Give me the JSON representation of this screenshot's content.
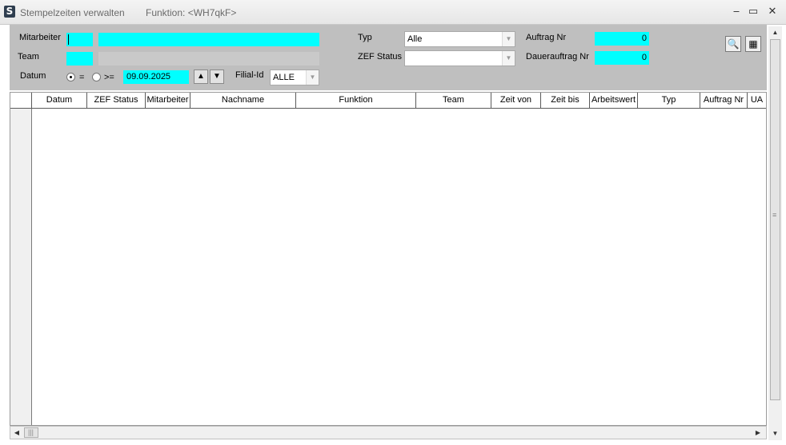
{
  "window": {
    "title": "Stempelzeiten verwalten",
    "function_label": "Funktion: <WH7qkF>",
    "minimize": "‒",
    "maximize": "▭",
    "close": "✕"
  },
  "filters": {
    "mitarbeiter_label": "Mitarbeiter",
    "team_label": "Team",
    "datum_label": "Datum",
    "radio_equal_label": "=",
    "radio_gte_label": ">=",
    "date_value": "09.09.2025",
    "filial_label": "Filial-Id",
    "filial_value": "ALLE",
    "typ_label": "Typ",
    "typ_value": "Alle",
    "zef_status_label": "ZEF Status",
    "zef_status_value": "",
    "auftrag_nr_label": "Auftrag Nr",
    "auftrag_nr_value": "0",
    "dauerauftrag_nr_label": "Dauerauftrag Nr",
    "dauerauftrag_nr_value": "0"
  },
  "grid": {
    "columns": [
      "Datum",
      "ZEF Status",
      "Mitarbeiter",
      "Nachname",
      "Funktion",
      "Team",
      "Zeit von",
      "Zeit bis",
      "Arbeitswert",
      "Typ",
      "Auftrag Nr",
      "UA"
    ],
    "rows": []
  },
  "icons": {
    "app": "app-logo-icon",
    "search": "search-magnifier-icon",
    "calculator": "calculator-icon"
  }
}
